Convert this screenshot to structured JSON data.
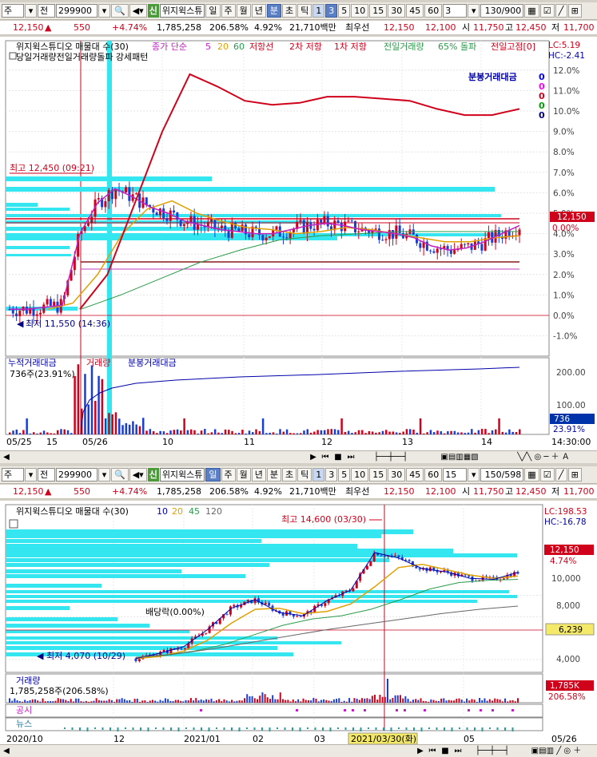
{
  "toolbar": {
    "market": "주",
    "all": "전",
    "code": "299900",
    "new_badge": "신",
    "name": "위지윅스튜",
    "period_top": [
      "일",
      "주",
      "월",
      "년",
      "분",
      "초",
      "틱"
    ],
    "nums_top": [
      "1",
      "3",
      "5",
      "10",
      "15",
      "30",
      "45",
      "60"
    ],
    "sel_top": "3",
    "count_top": "130/900",
    "nums_bottom": [
      "1",
      "3",
      "5",
      "10",
      "15",
      "30",
      "45",
      "60"
    ],
    "sel_bottom": "15",
    "count_bottom": "150/598"
  },
  "quote": {
    "price": "12,150",
    "change": "550",
    "rate": "+4.74%",
    "volume": "1,785,258",
    "vol_ratio": "206.58%",
    "turnover": "4.92%",
    "amount": "21,710백만",
    "best_label": "최우선",
    "ask": "12,150",
    "bid": "12,100",
    "open_label": "시",
    "open": "11,750",
    "high_label": "고",
    "high": "12,450",
    "low_label": "저",
    "low": "11,700"
  },
  "top_chart": {
    "legend": [
      "위지윅스튜디오 매물대 수(30)",
      "종가 단순",
      "5",
      "20",
      "60",
      "저항선",
      "2차 저항",
      "1차 저항",
      "전일거래량",
      "65% 돌파",
      "전일고점[0]"
    ],
    "subtitle": "당일거래량전일거래량돌파 강세패턴",
    "lc": "LC:5.19",
    "hc": "HC:-2.41",
    "bunbong_label": "분봉거래대금",
    "bunbong_values": [
      "0",
      "0",
      "0",
      "0",
      "0"
    ],
    "bunbong_colors": [
      "#0000ff",
      "#ff00ff",
      "#d0021b",
      "#00a000",
      "#000080"
    ],
    "max_label": "최고 12,450 (09:21)",
    "min_label": "최저 11,550 (14:36)",
    "y_ticks": [
      "12.0%",
      "11.0%",
      "10.0%",
      "9.0%",
      "8.0%",
      "7.0%",
      "6.0%",
      "5.0%",
      "4.0%",
      "3.0%",
      "2.0%",
      "1.0%",
      "0.0%",
      "-1.0%"
    ],
    "y_values": [
      12,
      11,
      10,
      9,
      8,
      7,
      6,
      5,
      4,
      3,
      2,
      1,
      0,
      -1
    ],
    "price_tag": "12,150",
    "pct_tag": "0.00%",
    "vol_legend": [
      "누적거래대금",
      "거래량",
      "분봉거래대금"
    ],
    "vol_sub": "736주(23.91%)",
    "vol_ticks": [
      "200.00",
      "100.00"
    ],
    "vol_tag": "736",
    "vol_tag2": "23.91%",
    "x_labels": [
      "05/25",
      "15",
      "05/26",
      "10",
      "11",
      "12",
      "13",
      "14",
      "14:30:00"
    ]
  },
  "bottom_chart": {
    "legend": [
      "위지윅스튜디오 매물대 수(30)",
      "10",
      "20",
      "45",
      "120"
    ],
    "lc": "LC:198.53",
    "hc": "HC:-16.78",
    "max_label": "최고 14,600 (03/30)",
    "min_label": "최저 4,070 (10/29)",
    "dividend_label": "배당락(0.00%)",
    "y_ticks": [
      "10,000",
      "8,000",
      "4,000"
    ],
    "price_tag": "12,150",
    "pct_tag": "4.74%",
    "tag2": "6,239",
    "vol_legend": "거래량",
    "vol_sub": "1,785,258주(206.58%)",
    "vol_tag": "1,785K",
    "vol_tag2": "206.58%",
    "notice_label": "공시",
    "news_label": "뉴스",
    "x_labels": [
      "2020/10",
      "12",
      "2021/01",
      "02",
      "03",
      "2021/03/30(화)",
      "05",
      "05/26"
    ]
  },
  "chart_data": [
    {
      "type": "line",
      "title": "",
      "series": [
        {
          "name": "종가 단순",
          "values": [
            0.3,
            0.3,
            0.4,
            0.5,
            4.0,
            5.5,
            6.2,
            5.8,
            5.3,
            5.0,
            4.6,
            4.4,
            4.2,
            4.1,
            4.0,
            4.0,
            4.2,
            4.4,
            4.5,
            4.4,
            4.2,
            4.1,
            4.0,
            3.8,
            3.4,
            3.2,
            3.3,
            3.6,
            4.0,
            4.4
          ]
        },
        {
          "name": "저항선",
          "values": [
            0.3,
            2.0,
            5.5,
            9.0,
            11.8,
            11.2,
            10.5,
            10.3,
            10.4,
            10.7,
            10.7,
            10.6,
            10.5,
            10.1,
            9.8,
            9.8,
            10.1
          ]
        }
      ],
      "ylim": [
        -1,
        12.5
      ]
    },
    {
      "type": "line",
      "title": "",
      "series": [
        {
          "name": "10",
          "values": [
            4100,
            4600,
            5200,
            6800,
            8800,
            9600,
            8400,
            8100,
            9500,
            10500,
            14000,
            13500,
            12500,
            12200,
            11600,
            11500,
            12150
          ]
        },
        {
          "name": "120",
          "values": [
            4200,
            4500,
            5000,
            5600,
            6200,
            6800,
            7300,
            7800,
            8300,
            8700,
            9000
          ]
        }
      ],
      "ylim": [
        3000,
        15500
      ]
    }
  ]
}
